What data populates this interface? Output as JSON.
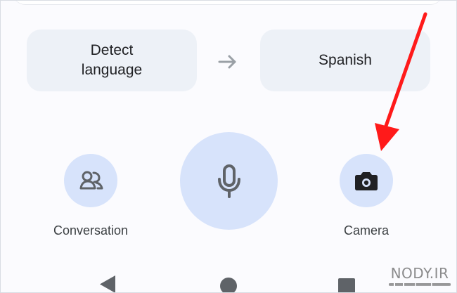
{
  "translator": {
    "source_language": "Detect\nlanguage",
    "target_language": "Spanish"
  },
  "actions": {
    "conversation_label": "Conversation",
    "camera_label": "Camera"
  },
  "icons": {
    "swap": "arrow-right-icon",
    "conversation": "people-icon",
    "microphone": "microphone-icon",
    "camera": "camera-icon",
    "back": "back-triangle-icon",
    "home": "home-circle-icon",
    "recents": "recents-square-icon"
  },
  "colors": {
    "language_button": "#edf1f7",
    "action_button": "#d7e3fb",
    "icon_primary": "#202124",
    "icon_secondary": "#5f6368",
    "highlight_arrow": "#ff1a1a"
  },
  "watermark": {
    "text": "NODY.IR"
  }
}
